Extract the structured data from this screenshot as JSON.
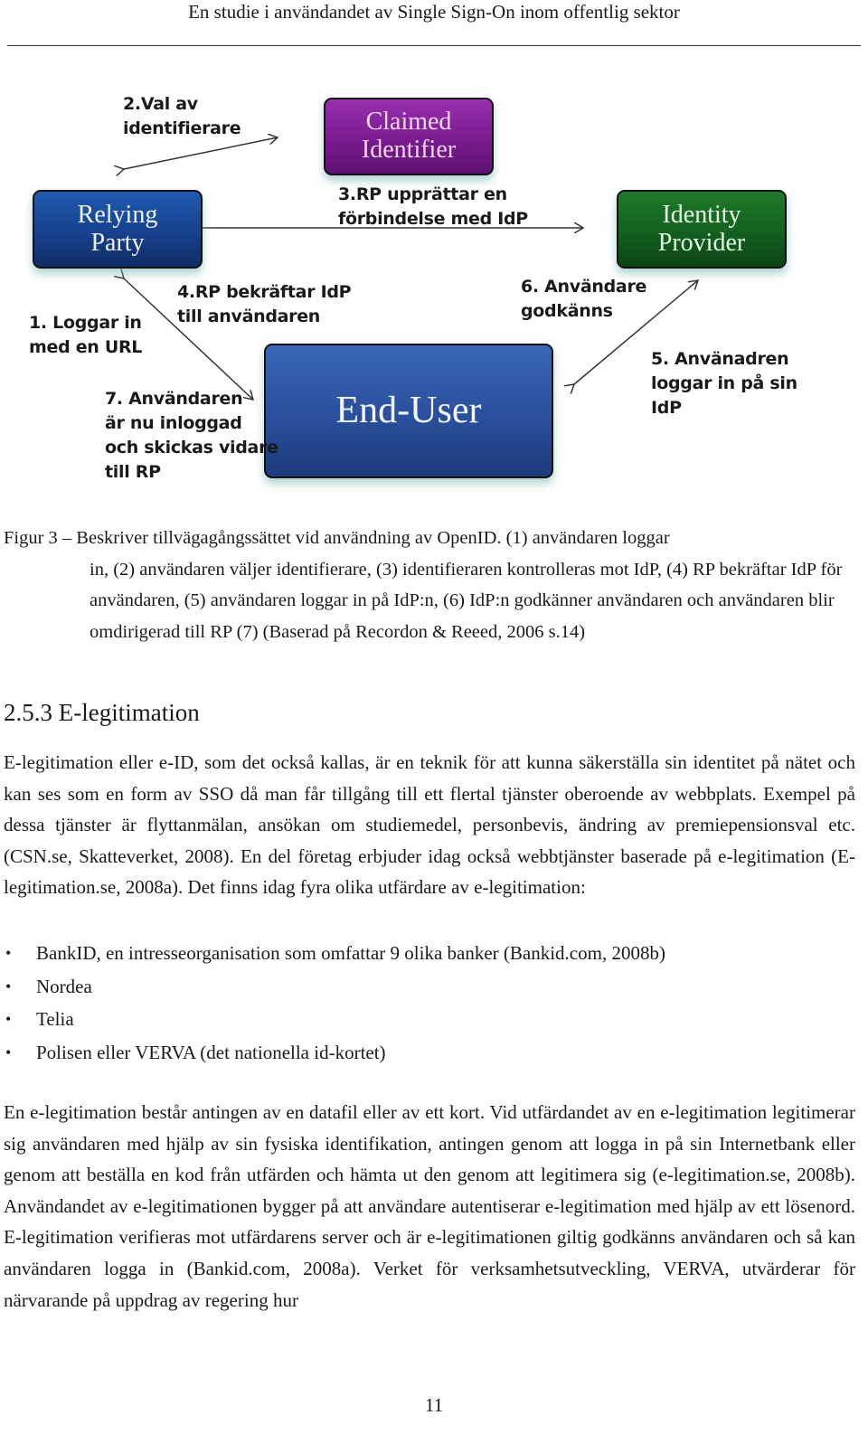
{
  "header": {
    "running_title": "En studie i användandet av Single Sign-On inom offentlig sektor"
  },
  "diagram": {
    "boxes": {
      "claimed_identifier": {
        "line1": "Claimed",
        "line2": "Identifier",
        "color": "#7a1b90"
      },
      "relying_party": {
        "line1": "Relying",
        "line2": "Party",
        "color": "#17418d"
      },
      "identity_provider": {
        "line1": "Identity",
        "line2": "Provider",
        "color": "#136020"
      },
      "end_user": {
        "line1": "End-User",
        "color": "#2a4f9c"
      }
    },
    "steps": {
      "step1": [
        "1. Loggar in",
        "med en URL"
      ],
      "step2": [
        "2.Val av",
        "identifierare"
      ],
      "step3": [
        "3.RP upprättar en",
        "förbindelse med IdP"
      ],
      "step4": [
        "4.RP bekräftar IdP",
        "till användaren"
      ],
      "step5": [
        "5. Använadren",
        "loggar in på sin",
        "IdP"
      ],
      "step6": [
        "6. Användare",
        "godkänns"
      ],
      "step7": [
        "7. Användaren",
        "är nu inloggad",
        "och skickas vidare",
        "till RP"
      ]
    }
  },
  "caption": {
    "first_line": "Figur 3 – Beskriver tillvägagångssättet vid användning av OpenID. (1) användaren loggar",
    "rest": "in, (2) användaren väljer identifierare, (3) identifieraren kontrolleras mot IdP, (4) RP bekräftar IdP för användaren, (5) användaren loggar in på IdP:n, (6) IdP:n godkänner användaren och användaren blir omdirigerad till RP (7) (Baserad på Recordon & Reeed, 2006 s.14)"
  },
  "section": {
    "heading": "2.5.3 E-legitimation",
    "paragraph1": "E-legitimation eller e-ID, som det också kallas, är en teknik för att kunna säkerställa sin identitet på nätet och kan ses som en form av SSO då man får tillgång till ett flertal tjänster oberoende av webbplats. Exempel på dessa tjänster är flyttanmälan, ansökan om studiemedel, personbevis, ändring av premiepensionsval etc. (CSN.se, Skatteverket, 2008). En del företag erbjuder idag också webbtjänster baserade på e-legitimation (E-legitimation.se, 2008a). Det finns idag fyra olika utfärdare av e-legitimation:",
    "bullets": [
      "BankID, en intresseorganisation som omfattar 9 olika banker (Bankid.com, 2008b)",
      "Nordea",
      "Telia",
      "Polisen eller VERVA (det nationella id-kortet)"
    ],
    "bullet_glyph": "•",
    "paragraph2": "En e-legitimation består antingen av en datafil eller av ett kort. Vid utfärdandet av en e-legitimation legitimerar sig användaren med hjälp av sin fysiska identifikation, antingen genom att logga in på sin Internetbank eller genom att beställa en kod från utfärden och hämta ut den genom att legitimera sig (e-legitimation.se, 2008b). Användandet av e-legitimationen bygger på att användare autentiserar e-legitimation med hjälp av ett lösenord. E-legitimation verifieras mot utfärdarens server och är e-legitimationen giltig godkänns användaren och så kan användaren logga in (Bankid.com, 2008a). Verket för verksamhetsutveckling, VERVA, utvärderar för närvarande på uppdrag av regering hur"
  },
  "footer": {
    "page_number": "11"
  }
}
